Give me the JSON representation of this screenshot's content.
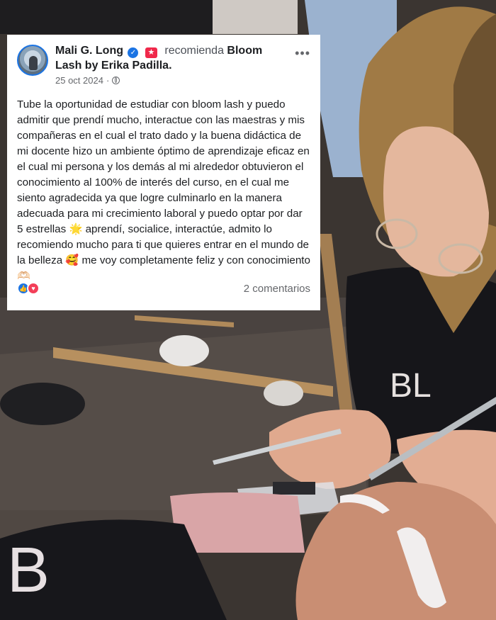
{
  "post": {
    "author": "Mali G. Long",
    "verified_icon": "check",
    "recommend_icon": "star-badge",
    "recommend_text": "recomienda",
    "page_name": "Bloom Lash by Erika Padilla.",
    "date": "25 oct 2024",
    "separator": "·",
    "privacy_icon": "globe-icon",
    "more_label": "•••",
    "body": "Tube la oportunidad de estudiar con bloom lash y puedo admitir que prendí mucho, interactue con las maestras y mis compañeras en el cual el trato dado y la buena didáctica de mi docente hizo un ambiente óptimo de aprendizaje eficaz en el cual mi persona y los demás al mi alrededor obtuvieron el conocimiento al 100% de interés del curso, en el cual me siento agradecida ya que logre culminarlo en la manera adecuada para mi crecimiento laboral y puedo optar por dar 5 estrellas 🌟 aprendí, socialice, interactúe, admito lo recomiendo mucho para ti que quieres entrar en el mundo de la belleza 🥰 me voy completamente feliz y con conocimiento 🫶🏻",
    "comments": "2 comentarios",
    "reactions": [
      "like",
      "love"
    ]
  },
  "photo": {
    "shirt_text_artist": "BL",
    "shirt_text_client": "B"
  },
  "colors": {
    "facebook_blue": "#1b74e4",
    "love_red": "#f33e58",
    "recommend_red": "#f0284a",
    "text_primary": "#1c1e21",
    "text_secondary": "#65676b"
  }
}
